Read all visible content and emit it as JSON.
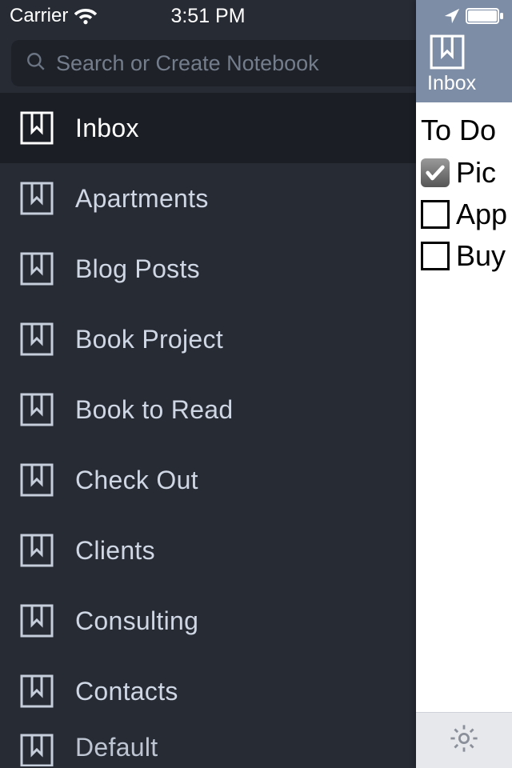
{
  "status": {
    "carrier": "Carrier",
    "time": "3:51 PM"
  },
  "search": {
    "placeholder": "Search or Create Notebook",
    "value": ""
  },
  "notebooks": {
    "selected_index": 0,
    "items": [
      {
        "label": "Inbox"
      },
      {
        "label": "Apartments"
      },
      {
        "label": "Blog Posts"
      },
      {
        "label": "Book Project"
      },
      {
        "label": "Book to Read"
      },
      {
        "label": "Check Out"
      },
      {
        "label": "Clients"
      },
      {
        "label": "Consulting"
      },
      {
        "label": "Contacts"
      },
      {
        "label": "Default"
      }
    ]
  },
  "peek": {
    "notebook_title": "Inbox",
    "note_title": "To Do",
    "todos": [
      {
        "text": "Pic",
        "checked": true
      },
      {
        "text": "App",
        "checked": false
      },
      {
        "text": "Buy",
        "checked": false
      }
    ]
  },
  "colors": {
    "bg": "#272b34",
    "bg_selected": "#1b1e25",
    "search_bg": "#1e2128",
    "accent": "#5a7fa7",
    "peek_header": "#7d8da5"
  }
}
